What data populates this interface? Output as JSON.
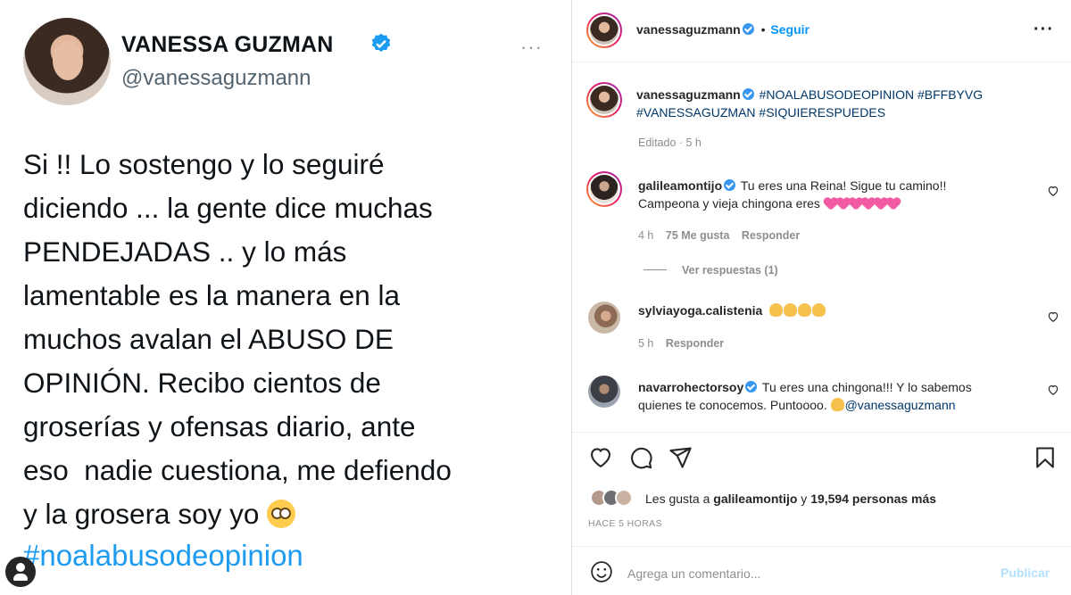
{
  "tweet": {
    "name": "VANESSA GUZMAN",
    "handle": "@vanessaguzmann",
    "more": "···",
    "body": "Si !! Lo sostengo y lo seguiré\ndiciendo ... la gente dice muchas\nPENDEJADAS .. y lo más\nlamentable es la manera en la\nmuchos avalan el ABUSO DE\nOPINIÓN. Recibo cientos de\ngroserías y ofensas diario, ante\neso  nadie cuestiona, me defiendo\ny la grosera soy yo",
    "hashtag": "#noalabusodeopinion",
    "colors": {
      "link": "#1d9bf0",
      "verified": "#1d9bf0"
    }
  },
  "instagram": {
    "header": {
      "username": "vanessaguzmann",
      "dot": "•",
      "follow": "Seguir",
      "more": "···"
    },
    "caption": {
      "username": "vanessaguzmann",
      "tags_line1": "#NOALABUSODEOPINION #BFFBYVG",
      "tags_line2": "#VANESSAGUZMAN #SIQUIERESPUEDES",
      "meta": "Editado · 5 h"
    },
    "comments": [
      {
        "username": "galileamontijo",
        "text_line1": "Tu eres una Reina! Sigue tu camino!!",
        "text_line2": "Campeona y vieja chingona eres",
        "time": "4 h",
        "likes": "75 Me gusta",
        "reply": "Responder",
        "view_replies": "Ver respuestas (1)"
      },
      {
        "username": "sylviayoga.calistenia",
        "time": "5 h",
        "reply": "Responder"
      },
      {
        "username": "navarrohectorsoy",
        "text_line1": "Tu eres una chingona!!! Y lo sabemos",
        "text_line2": "quienes te conocemos. Puntoooo.",
        "mention": "@vanessaguzmann"
      }
    ],
    "likes": {
      "prefix": "Les gusta a",
      "user": "galileamontijo",
      "connector": "y",
      "others": "19,594 personas más"
    },
    "timestamp": "HACE 5 HORAS",
    "comment_box": {
      "placeholder": "Agrega un comentario...",
      "publish": "Publicar"
    },
    "colors": {
      "link": "#00376b",
      "follow": "#0095f6",
      "muted": "#8e8e8e",
      "publish_disabled": "#b2dffc"
    }
  }
}
